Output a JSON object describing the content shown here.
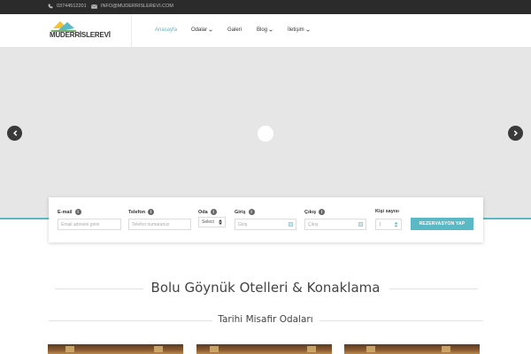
{
  "topbar": {
    "phone": "03744512201",
    "email": "INFO@MUDERRISLEREVI.COM",
    "phone_icon": "phone-icon",
    "email_icon": "envelope-icon"
  },
  "logo": {
    "text": "MÜDERRİSLEREVİ"
  },
  "nav": {
    "items": [
      {
        "label": "Anasayfa",
        "active": true,
        "dropdown": false
      },
      {
        "label": "Odalar",
        "active": false,
        "dropdown": true
      },
      {
        "label": "Galeri",
        "active": false,
        "dropdown": false
      },
      {
        "label": "Blog",
        "active": false,
        "dropdown": true
      },
      {
        "label": "İletişim",
        "active": false,
        "dropdown": true
      }
    ]
  },
  "hero": {
    "prev_icon": "chevron-left-icon",
    "next_icon": "chevron-right-icon"
  },
  "booking": {
    "email": {
      "label": "E-mail",
      "placeholder": "Email adresini girini"
    },
    "phone": {
      "label": "Telefon",
      "placeholder": "Telefon numaranızı"
    },
    "room": {
      "label": "Oda",
      "selected": "Select"
    },
    "checkin": {
      "label": "Giriş",
      "placeholder": "Giriş"
    },
    "checkout": {
      "label": "Çıkış",
      "placeholder": "Çıkış"
    },
    "guests": {
      "label": "Kişi sayısı",
      "value": "1"
    },
    "submit": "REZERVASYON YAP"
  },
  "main": {
    "title": "Bolu Göynük Otelleri & Konaklama",
    "subtitle": "Tarihi Misafir Odaları"
  },
  "colors": {
    "accent": "#5ab9c4",
    "topbar_bg": "#2b2b2b",
    "hero_bg": "#e6e6e6"
  }
}
